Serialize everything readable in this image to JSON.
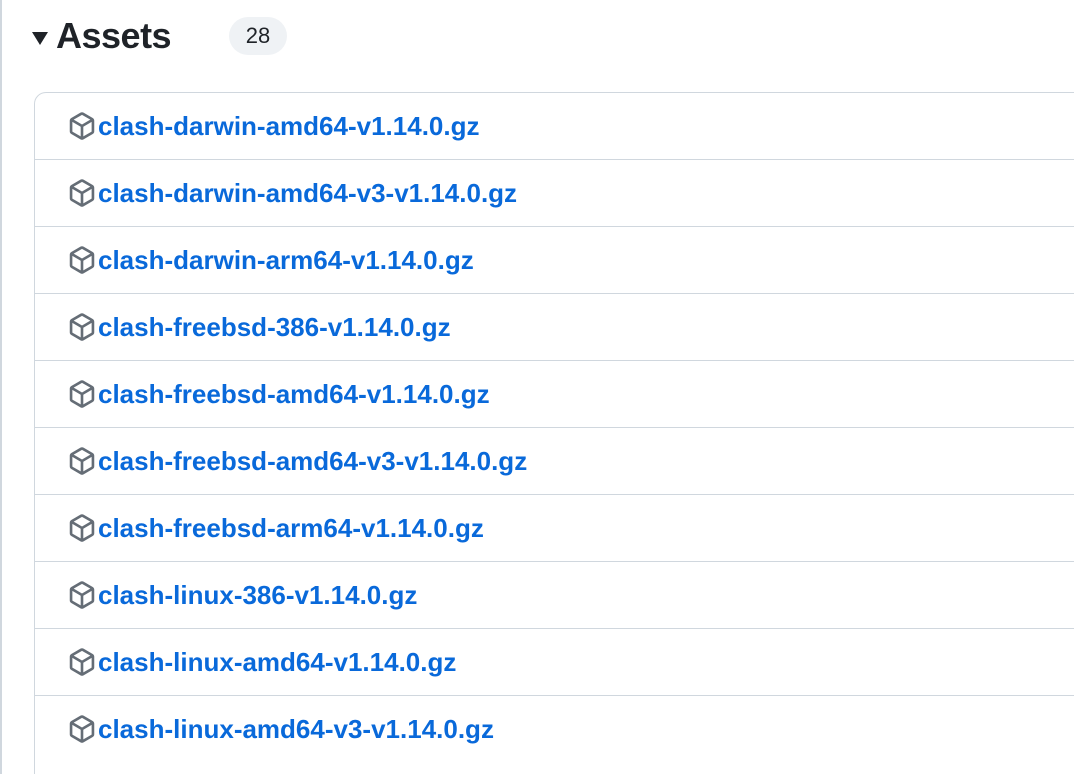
{
  "assets": {
    "title": "Assets",
    "count": "28",
    "caret_icon": "triangle-down-icon",
    "item_icon": "package-icon",
    "link_color": "#0969da",
    "items": [
      {
        "name": "clash-darwin-amd64-v1.14.0.gz"
      },
      {
        "name": "clash-darwin-amd64-v3-v1.14.0.gz"
      },
      {
        "name": "clash-darwin-arm64-v1.14.0.gz"
      },
      {
        "name": "clash-freebsd-386-v1.14.0.gz"
      },
      {
        "name": "clash-freebsd-amd64-v1.14.0.gz"
      },
      {
        "name": "clash-freebsd-amd64-v3-v1.14.0.gz"
      },
      {
        "name": "clash-freebsd-arm64-v1.14.0.gz"
      },
      {
        "name": "clash-linux-386-v1.14.0.gz"
      },
      {
        "name": "clash-linux-amd64-v1.14.0.gz"
      },
      {
        "name": "clash-linux-amd64-v3-v1.14.0.gz"
      }
    ]
  }
}
